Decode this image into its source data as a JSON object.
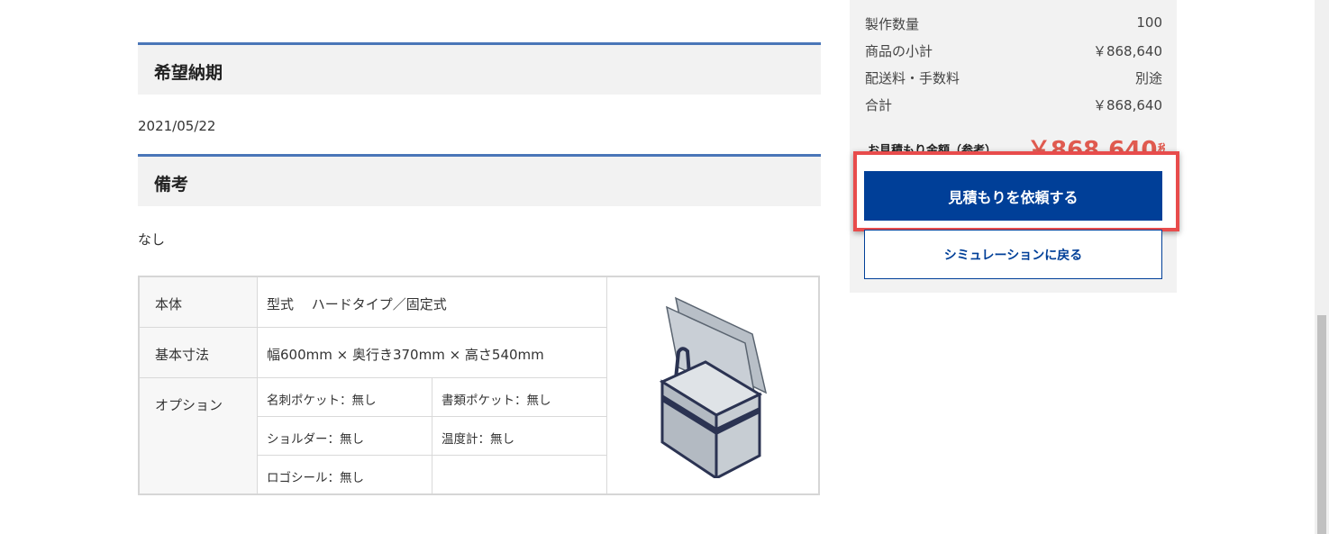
{
  "delivery": {
    "heading": "希望納期",
    "value": "2021/05/22"
  },
  "remarks": {
    "heading": "備考",
    "value": "なし"
  },
  "spec": {
    "body_label": "本体",
    "body_value": "型式　 ハードタイプ／固定式",
    "size_label": "基本寸法",
    "size_value": "幅600mm × 奥行き370mm × 高さ540mm",
    "options_label": "オプション",
    "options": [
      "名刺ポケット：無し",
      "書類ポケット：無し",
      "ショルダー：無し",
      "温度計：無し",
      "ロゴシール：無し"
    ]
  },
  "summary": {
    "rows": [
      {
        "label": "製作数量",
        "value": "100"
      },
      {
        "label": "商品の小計",
        "value": "￥868,640"
      },
      {
        "label": "配送料・手数料",
        "value": "別途"
      },
      {
        "label": "合計",
        "value": "￥868,640"
      }
    ],
    "estimate_label": "お見積もり金額（参考）",
    "estimate_value": "￥868,640",
    "tax_label": "税込",
    "request_button": "見積もりを依頼する",
    "back_button": "シミュレーションに戻る"
  },
  "colors": {
    "accent_blue": "#003f98",
    "section_border": "#4a76b8",
    "highlight_red": "#e84c4c",
    "price_red": "#e05a4f"
  }
}
